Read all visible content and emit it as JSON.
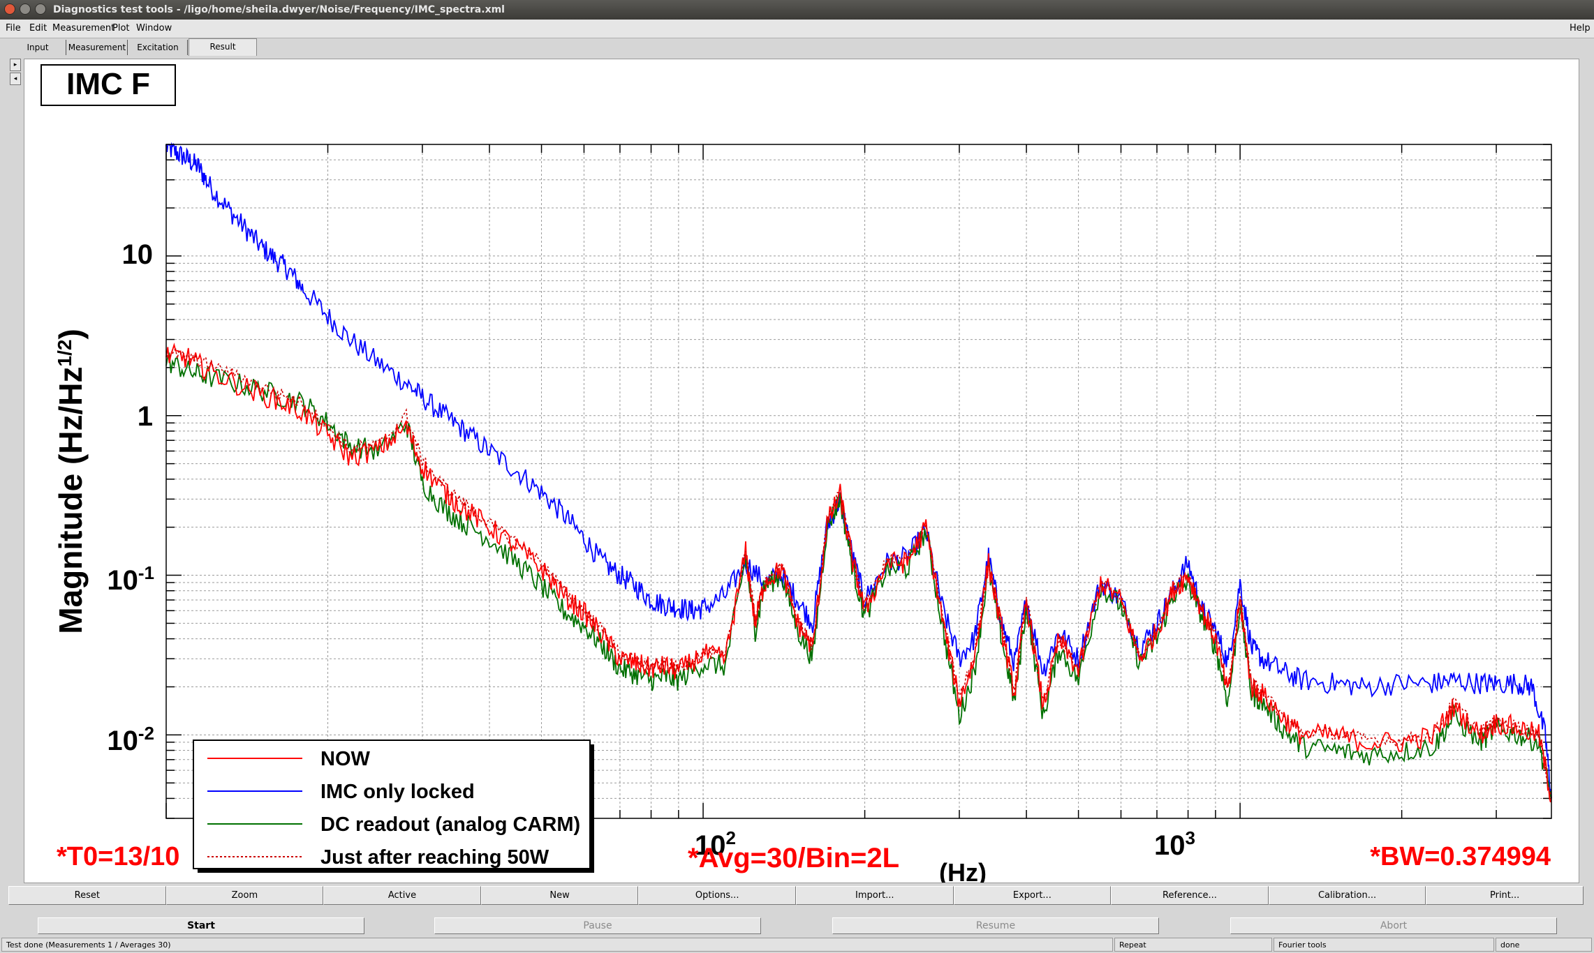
{
  "window": {
    "title": "Diagnostics test tools - /ligo/home/sheila.dwyer/Noise/Frequency/IMC_spectra.xml"
  },
  "menu": {
    "file": "File",
    "edit": "Edit",
    "measurement": "Measurement",
    "plot": "Plot",
    "window": "Window",
    "help": "Help"
  },
  "tabs": {
    "input": "Input",
    "measurement": "Measurement",
    "excitation": "Excitation",
    "result": "Result"
  },
  "side": {
    "up": "▸",
    "down": "◂"
  },
  "plot": {
    "title": "IMC F",
    "ylabel_main": "Magnitude (Hz/Hz",
    "ylabel_sup": "1/2",
    "ylabel_close": ")",
    "ytick_10": "10",
    "ytick_1": "1",
    "ytick_base1": "10",
    "ytick_exp1": "-1",
    "ytick_base2": "10",
    "ytick_exp2": "-2",
    "xtick_base1": "10",
    "xtick_exp1": "2",
    "xtick_base2": "10",
    "xtick_exp2": "3",
    "xlabel_fragment": "(Hz)",
    "info_t0": "*T0=13/10",
    "info_avg": "*Avg=30/Bin=2L",
    "info_bw": "*BW=0.374994"
  },
  "chart_data": {
    "type": "line",
    "title": "IMC F",
    "xlabel": "(Hz)",
    "ylabel": "Magnitude (Hz/Hz^1/2)",
    "xscale": "log",
    "yscale": "log",
    "xlim": [
      10,
      3800
    ],
    "ylim": [
      0.003,
      50
    ],
    "grid": true,
    "legend_position": "bottom-left",
    "series": [
      {
        "name": "NOW",
        "color": "#ff0000",
        "style": "solid",
        "x": [
          10,
          11,
          12,
          14,
          16,
          18,
          20,
          22,
          25,
          28,
          30,
          33,
          36,
          40,
          45,
          50,
          55,
          60,
          65,
          70,
          75,
          80,
          85,
          90,
          100,
          110,
          120,
          125,
          130,
          140,
          150,
          160,
          170,
          180,
          190,
          200,
          220,
          240,
          260,
          280,
          300,
          320,
          340,
          360,
          380,
          400,
          430,
          460,
          500,
          550,
          600,
          650,
          700,
          750,
          800,
          850,
          900,
          950,
          1000,
          1050,
          1100,
          1200,
          1300,
          1500,
          1700,
          2000,
          2300,
          2500,
          2800,
          3000,
          3300,
          3600,
          3800
        ],
        "y": [
          2.4,
          2.3,
          1.9,
          1.5,
          1.25,
          1.05,
          0.75,
          0.55,
          0.62,
          0.85,
          0.48,
          0.33,
          0.26,
          0.2,
          0.15,
          0.11,
          0.075,
          0.058,
          0.042,
          0.03,
          0.028,
          0.026,
          0.027,
          0.025,
          0.032,
          0.03,
          0.14,
          0.05,
          0.09,
          0.11,
          0.05,
          0.035,
          0.21,
          0.32,
          0.12,
          0.06,
          0.12,
          0.12,
          0.2,
          0.05,
          0.016,
          0.03,
          0.12,
          0.045,
          0.018,
          0.07,
          0.015,
          0.04,
          0.025,
          0.09,
          0.07,
          0.03,
          0.045,
          0.08,
          0.1,
          0.06,
          0.04,
          0.018,
          0.07,
          0.02,
          0.018,
          0.013,
          0.01,
          0.01,
          0.009,
          0.009,
          0.01,
          0.015,
          0.01,
          0.012,
          0.011,
          0.01,
          0.004
        ]
      },
      {
        "name": "IMC only locked",
        "color": "#0000ff",
        "style": "solid",
        "x": [
          10,
          10.5,
          11,
          11.5,
          12,
          13,
          14,
          15,
          16,
          17,
          18,
          20,
          22,
          25,
          28,
          30,
          33,
          36,
          40,
          45,
          50,
          55,
          60,
          65,
          70,
          75,
          80,
          85,
          90,
          95,
          100,
          110,
          120,
          130,
          140,
          150,
          160,
          170,
          180,
          190,
          200,
          220,
          240,
          260,
          280,
          300,
          320,
          340,
          360,
          380,
          400,
          430,
          460,
          500,
          550,
          600,
          650,
          700,
          750,
          800,
          850,
          900,
          950,
          1000,
          1050,
          1100,
          1200,
          1300,
          1500,
          1700,
          2000,
          2300,
          2500,
          2800,
          3000,
          3300,
          3500,
          3700,
          3800
        ],
        "y": [
          48,
          44,
          40,
          36,
          28,
          20,
          15,
          11.5,
          9.5,
          8.0,
          6.2,
          4.2,
          3.0,
          2.1,
          1.6,
          1.3,
          1.0,
          0.8,
          0.6,
          0.45,
          0.33,
          0.24,
          0.17,
          0.12,
          0.1,
          0.085,
          0.07,
          0.065,
          0.063,
          0.06,
          0.062,
          0.075,
          0.12,
          0.09,
          0.1,
          0.07,
          0.05,
          0.2,
          0.3,
          0.13,
          0.07,
          0.12,
          0.13,
          0.19,
          0.06,
          0.03,
          0.04,
          0.13,
          0.05,
          0.028,
          0.07,
          0.025,
          0.045,
          0.03,
          0.09,
          0.07,
          0.035,
          0.05,
          0.08,
          0.12,
          0.06,
          0.045,
          0.028,
          0.09,
          0.035,
          0.03,
          0.025,
          0.022,
          0.021,
          0.02,
          0.021,
          0.021,
          0.022,
          0.021,
          0.021,
          0.021,
          0.02,
          0.01,
          0.004
        ]
      },
      {
        "name": "DC readout (analog CARM)",
        "color": "#007000",
        "style": "solid",
        "x": [
          10,
          11,
          12,
          14,
          16,
          18,
          20,
          22,
          25,
          28,
          30,
          33,
          36,
          40,
          45,
          50,
          55,
          60,
          65,
          70,
          75,
          80,
          85,
          90,
          100,
          110,
          120,
          125,
          130,
          140,
          150,
          160,
          170,
          180,
          190,
          200,
          220,
          240,
          260,
          280,
          300,
          320,
          340,
          360,
          380,
          400,
          430,
          460,
          500,
          550,
          600,
          650,
          700,
          750,
          800,
          850,
          900,
          950,
          1000,
          1050,
          1100,
          1200,
          1300,
          1500,
          1700,
          2000,
          2300,
          2500,
          2800,
          3000,
          3300,
          3600,
          3800
        ],
        "y": [
          2.2,
          1.9,
          1.75,
          1.55,
          1.35,
          1.2,
          0.9,
          0.65,
          0.6,
          0.9,
          0.38,
          0.26,
          0.21,
          0.17,
          0.12,
          0.085,
          0.06,
          0.048,
          0.036,
          0.026,
          0.024,
          0.022,
          0.023,
          0.022,
          0.028,
          0.027,
          0.13,
          0.045,
          0.085,
          0.1,
          0.045,
          0.03,
          0.2,
          0.3,
          0.11,
          0.055,
          0.11,
          0.11,
          0.19,
          0.045,
          0.013,
          0.025,
          0.11,
          0.04,
          0.016,
          0.065,
          0.013,
          0.035,
          0.022,
          0.085,
          0.065,
          0.028,
          0.04,
          0.075,
          0.09,
          0.055,
          0.035,
          0.016,
          0.065,
          0.018,
          0.016,
          0.011,
          0.0085,
          0.008,
          0.0075,
          0.0078,
          0.0085,
          0.013,
          0.009,
          0.011,
          0.01,
          0.009,
          0.004
        ]
      },
      {
        "name": "Just after reaching 50W",
        "color": "#cc0000",
        "style": "dotted",
        "x": [
          10,
          11,
          12,
          14,
          16,
          18,
          20,
          22,
          25,
          28,
          30,
          33,
          36,
          40,
          45,
          50,
          55,
          60,
          65,
          70,
          75,
          80,
          85,
          90,
          100,
          110,
          120,
          125,
          130,
          140,
          150,
          160,
          170,
          180,
          190,
          200,
          220,
          240,
          260,
          280,
          300,
          320,
          340,
          360,
          380,
          400,
          430,
          460,
          500,
          550,
          600,
          650,
          700,
          750,
          800,
          850,
          900,
          950,
          1000,
          1050,
          1100,
          1200,
          1300,
          1500,
          1700,
          2000,
          2300,
          2500,
          2800,
          3000,
          3300,
          3600,
          3800
        ],
        "y": [
          2.5,
          2.3,
          2.1,
          1.7,
          1.4,
          1.2,
          0.85,
          0.62,
          0.66,
          1.0,
          0.52,
          0.36,
          0.28,
          0.21,
          0.16,
          0.12,
          0.08,
          0.06,
          0.045,
          0.032,
          0.029,
          0.027,
          0.028,
          0.026,
          0.033,
          0.031,
          0.145,
          0.052,
          0.092,
          0.112,
          0.052,
          0.036,
          0.215,
          0.33,
          0.125,
          0.062,
          0.125,
          0.125,
          0.205,
          0.052,
          0.017,
          0.031,
          0.125,
          0.047,
          0.019,
          0.072,
          0.016,
          0.041,
          0.026,
          0.092,
          0.072,
          0.031,
          0.046,
          0.082,
          0.105,
          0.062,
          0.042,
          0.019,
          0.072,
          0.021,
          0.019,
          0.013,
          0.0105,
          0.0102,
          0.0095,
          0.0092,
          0.0102,
          0.016,
          0.0105,
          0.0122,
          0.0112,
          0.0102,
          0.004
        ]
      }
    ]
  },
  "buttons": {
    "reset": "Reset",
    "zoom": "Zoom",
    "active": "Active",
    "new": "New",
    "options": "Options...",
    "import": "Import...",
    "export": "Export...",
    "reference": "Reference...",
    "calibration": "Calibration...",
    "print": "Print..."
  },
  "controls": {
    "start": "Start",
    "pause": "Pause",
    "resume": "Resume",
    "abort": "Abort"
  },
  "status": {
    "message": "Test done (Measurements 1 / Averages 30)",
    "repeat": "Repeat",
    "tool": "Fourier tools",
    "state": "done"
  }
}
